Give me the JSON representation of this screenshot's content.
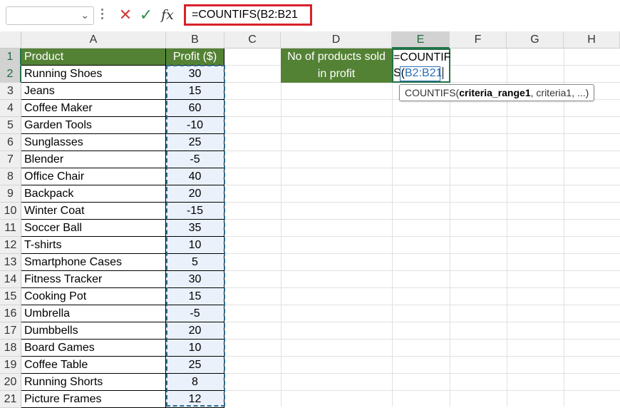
{
  "formula_bar": {
    "name_box": "",
    "cancel_icon": "✕",
    "enter_icon": "✓",
    "fx_label": "fx",
    "formula": "=COUNTIFS(B2:B21"
  },
  "columns": [
    "A",
    "B",
    "C",
    "D",
    "E",
    "F",
    "G",
    "H"
  ],
  "rows": [
    "1",
    "2",
    "3",
    "4",
    "5",
    "6",
    "7",
    "8",
    "9",
    "10",
    "11",
    "12",
    "13",
    "14",
    "15",
    "16",
    "17",
    "18",
    "19",
    "20",
    "21"
  ],
  "table": {
    "headers": {
      "product": "Product",
      "profit": "Profit ($)"
    },
    "data": [
      {
        "product": "Running Shoes",
        "profit": "30"
      },
      {
        "product": "Jeans",
        "profit": "15"
      },
      {
        "product": "Coffee Maker",
        "profit": "60"
      },
      {
        "product": "Garden Tools",
        "profit": "-10"
      },
      {
        "product": "Sunglasses",
        "profit": "25"
      },
      {
        "product": "Blender",
        "profit": "-5"
      },
      {
        "product": "Office Chair",
        "profit": "40"
      },
      {
        "product": "Backpack",
        "profit": "20"
      },
      {
        "product": "Winter Coat",
        "profit": "-15"
      },
      {
        "product": "Soccer Ball",
        "profit": "35"
      },
      {
        "product": "T-shirts",
        "profit": "10"
      },
      {
        "product": "Smartphone Cases",
        "profit": "5"
      },
      {
        "product": "Fitness Tracker",
        "profit": "30"
      },
      {
        "product": "Cooking Pot",
        "profit": "15"
      },
      {
        "product": "Umbrella",
        "profit": "-5"
      },
      {
        "product": "Dumbbells",
        "profit": "20"
      },
      {
        "product": "Board Games",
        "profit": "10"
      },
      {
        "product": "Coffee Table",
        "profit": "25"
      },
      {
        "product": "Running Shorts",
        "profit": "8"
      },
      {
        "product": "Picture Frames",
        "profit": "12"
      }
    ]
  },
  "summary": {
    "label_line1": "No of products sold",
    "label_line2": "in profit",
    "edit_line1": "=COUNTIF",
    "edit_line2_prefix": "S(",
    "edit_line2_ref": "B2:B21"
  },
  "tooltip": {
    "func": "COUNTIFS(",
    "arg_bold": "criteria_range1",
    "rest": ", criteria1, ...)"
  },
  "colors": {
    "header_green": "#548235",
    "selection_green": "#217346",
    "highlight_red": "#d7212c",
    "ref_blue": "#2e6fb5"
  }
}
